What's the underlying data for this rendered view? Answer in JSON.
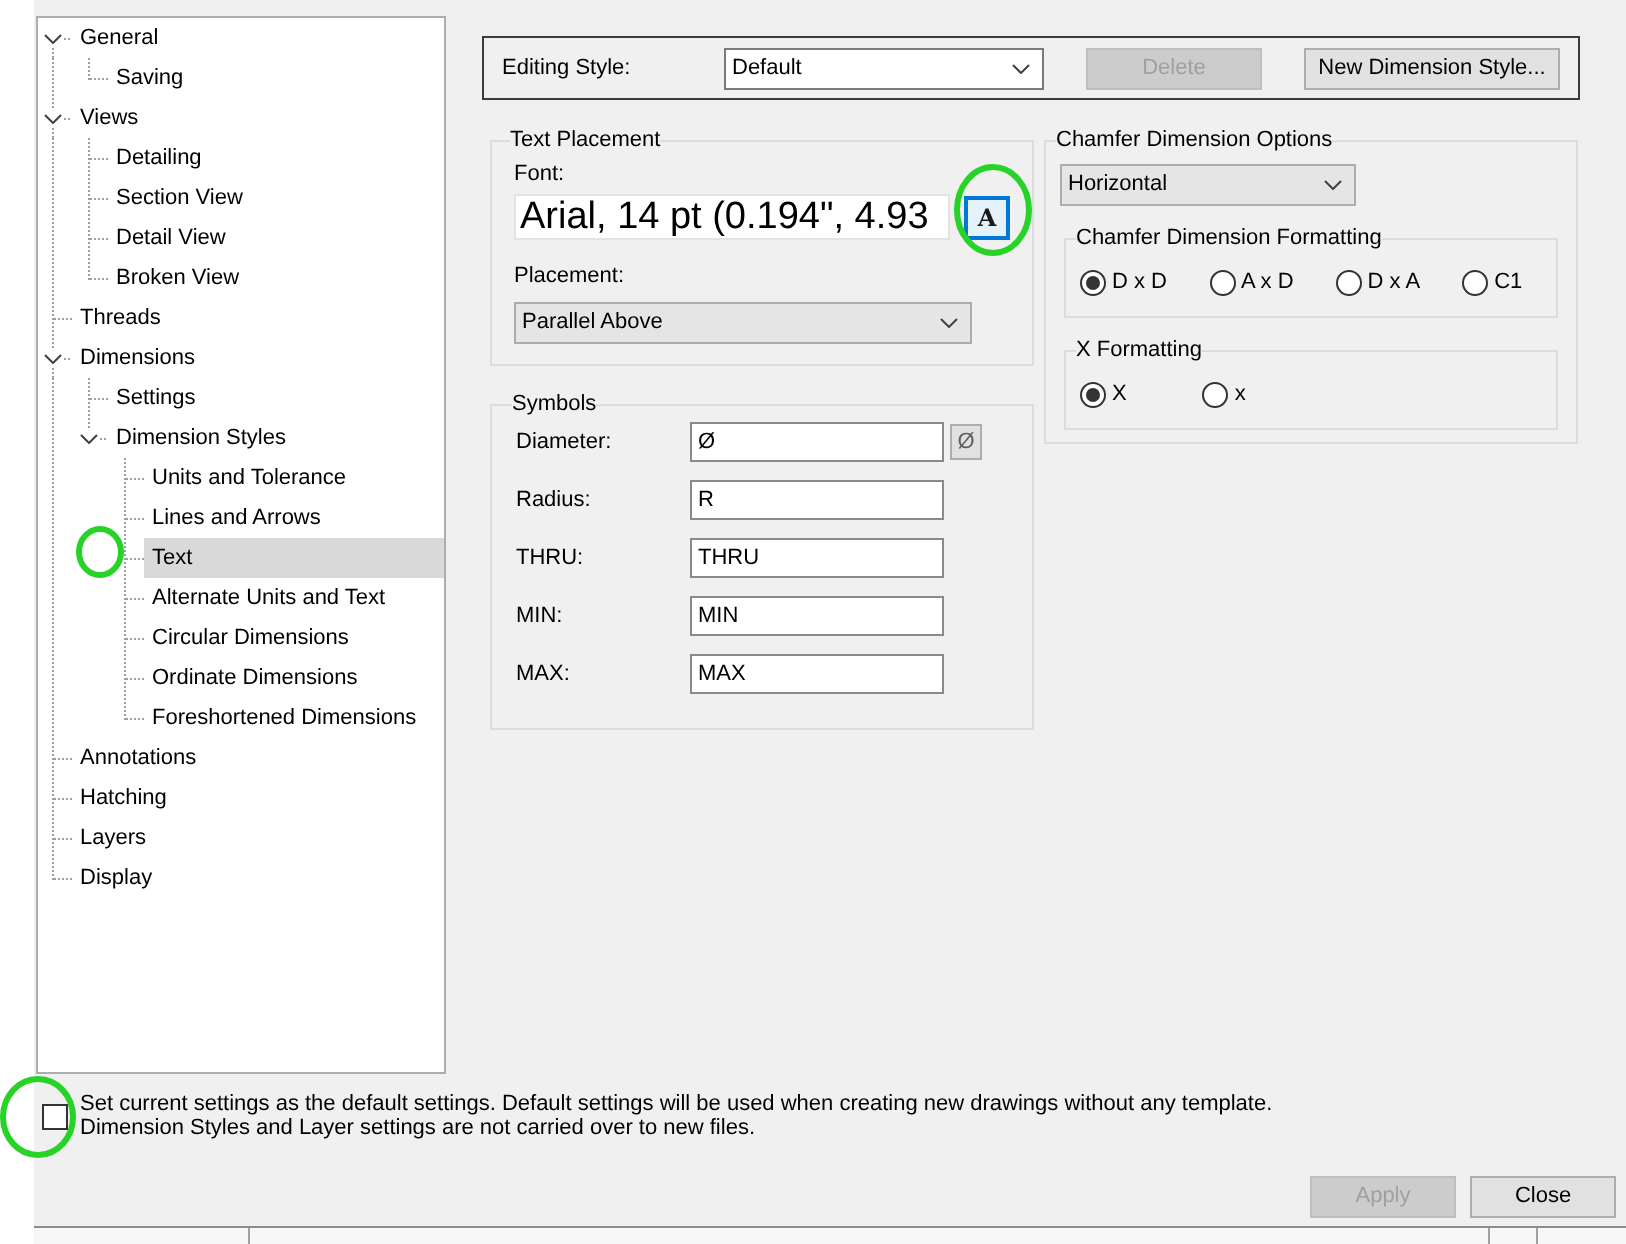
{
  "sidebar": {
    "items": [
      {
        "label": "General",
        "expanded": true,
        "selected": false,
        "circled": false,
        "children": [
          {
            "label": "Saving",
            "selected": false,
            "circled": false
          }
        ]
      },
      {
        "label": "Views",
        "expanded": true,
        "selected": false,
        "circled": false,
        "children": [
          {
            "label": "Detailing",
            "selected": false,
            "circled": false
          },
          {
            "label": "Section View",
            "selected": false,
            "circled": false
          },
          {
            "label": "Detail View",
            "selected": false,
            "circled": false
          },
          {
            "label": "Broken View",
            "selected": false,
            "circled": false
          }
        ]
      },
      {
        "label": "Threads",
        "selected": false,
        "circled": false
      },
      {
        "label": "Dimensions",
        "expanded": true,
        "selected": false,
        "circled": false,
        "children": [
          {
            "label": "Settings",
            "selected": false,
            "circled": false
          },
          {
            "label": "Dimension Styles",
            "expanded": true,
            "selected": false,
            "circled": false,
            "children": [
              {
                "label": "Units and Tolerance",
                "selected": false,
                "circled": false
              },
              {
                "label": "Lines and Arrows",
                "selected": false,
                "circled": false
              },
              {
                "label": "Text",
                "selected": true,
                "circled": true
              },
              {
                "label": "Alternate Units and Text",
                "selected": false,
                "circled": false
              },
              {
                "label": "Circular Dimensions",
                "selected": false,
                "circled": false
              },
              {
                "label": "Ordinate Dimensions",
                "selected": false,
                "circled": false
              },
              {
                "label": "Foreshortened Dimensions",
                "selected": false,
                "circled": false
              }
            ]
          }
        ]
      },
      {
        "label": "Annotations",
        "selected": false,
        "circled": false
      },
      {
        "label": "Hatching",
        "selected": false,
        "circled": false
      },
      {
        "label": "Layers",
        "selected": false,
        "circled": false
      },
      {
        "label": "Display",
        "selected": false,
        "circled": false
      }
    ]
  },
  "editing_style": {
    "label": "Editing Style:",
    "value": "Default",
    "buttons": [
      {
        "label": "Delete",
        "disabled": true
      },
      {
        "label": "New Dimension Style...",
        "disabled": false
      }
    ]
  },
  "text_placement": {
    "title": "Text Placement",
    "font_label": "Font:",
    "font_value": "Arial, 14 pt (0.194\", 4.93",
    "font_button": {
      "label": "A",
      "circled": true
    },
    "placement_label": "Placement:",
    "placement_value": "Parallel Above"
  },
  "symbols": {
    "title": "Symbols",
    "rows": [
      {
        "label": "Diameter:",
        "value": "Ø",
        "button": "Ø"
      },
      {
        "label": "Radius:",
        "value": "R"
      },
      {
        "label": "THRU:",
        "value": "THRU"
      },
      {
        "label": "MIN:",
        "value": "MIN"
      },
      {
        "label": "MAX:",
        "value": "MAX"
      }
    ]
  },
  "chamfer": {
    "title": "Chamfer Dimension Options",
    "orientation": "Horizontal",
    "formatting": {
      "title": "Chamfer Dimension Formatting",
      "options": [
        {
          "label": "D x D",
          "selected": true
        },
        {
          "label": "A x D",
          "selected": false
        },
        {
          "label": "D x A",
          "selected": false
        },
        {
          "label": "C1",
          "selected": false
        }
      ]
    },
    "x_formatting": {
      "title": "X Formatting",
      "options": [
        {
          "label": "X",
          "selected": true
        },
        {
          "label": "x",
          "selected": false
        }
      ]
    }
  },
  "default_settings": {
    "checked": false,
    "circled": true,
    "lines": [
      "Set current settings as the default settings. Default settings will be used when creating new drawings without any template.",
      "Dimension Styles and Layer settings are not carried over to new files."
    ]
  },
  "buttons": [
    {
      "label": "Apply",
      "disabled": true
    },
    {
      "label": "Close",
      "disabled": false
    }
  ]
}
